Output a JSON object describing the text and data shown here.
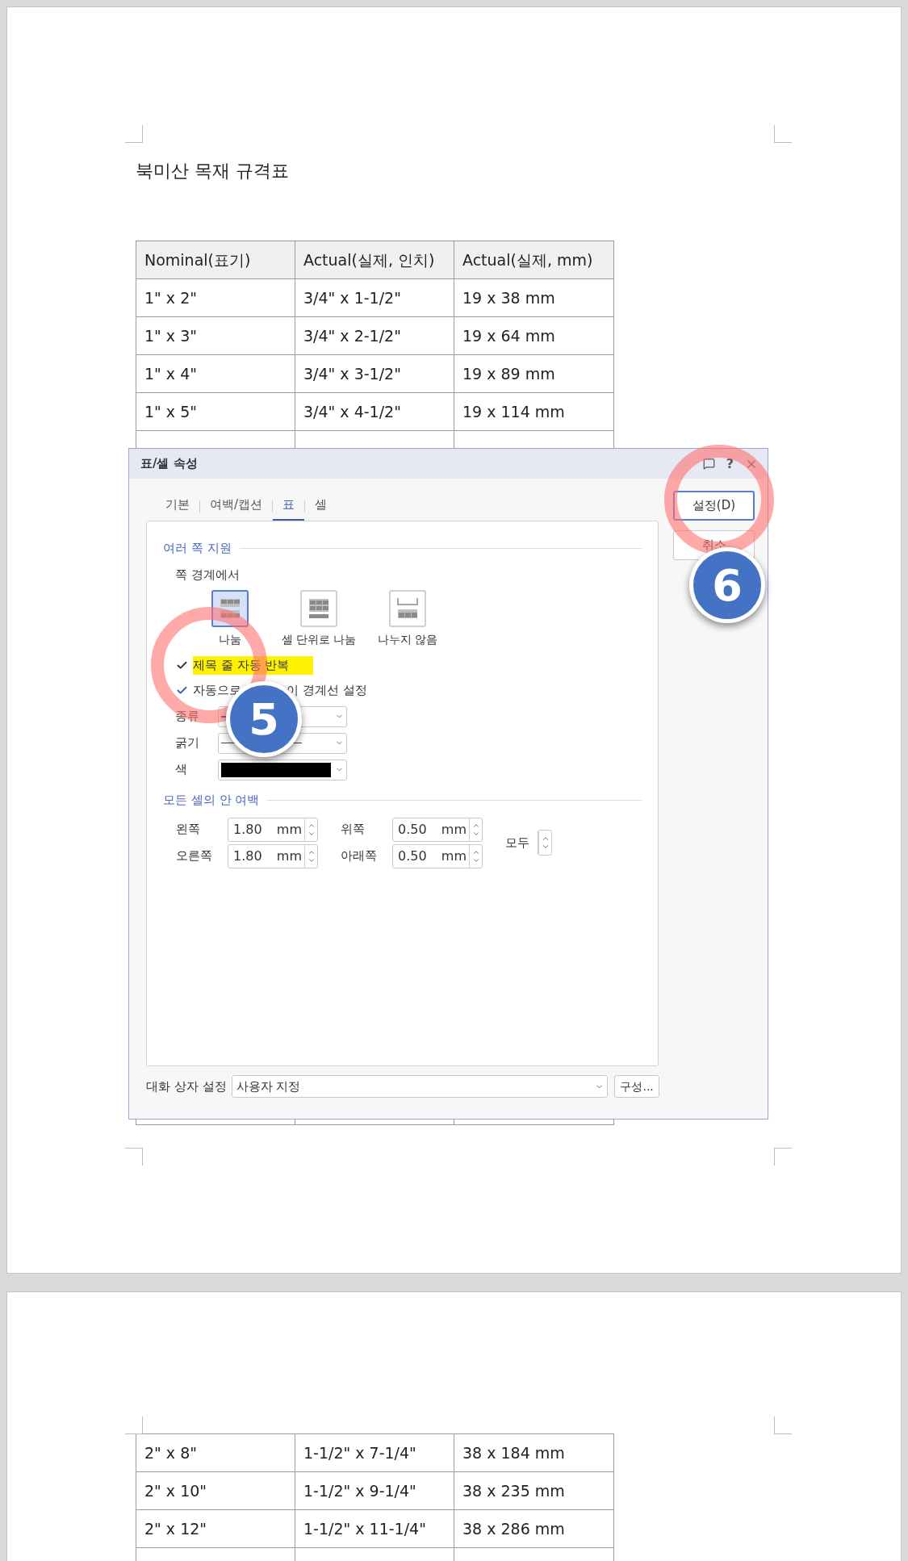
{
  "document": {
    "title": "북미산 목재 규격표",
    "columns": [
      "Nominal(표기)",
      "Actual(실제, 인치)",
      "Actual(실제, mm)"
    ],
    "rows": [
      [
        "1\" x 2\"",
        "3/4\" x 1-1/2\"",
        "19 x 38 mm"
      ],
      [
        "1\" x 3\"",
        "3/4\" x 2-1/2\"",
        "19 x 64 mm"
      ],
      [
        "1\" x 4\"",
        "3/4\" x 3-1/2\"",
        "19 x 89 mm"
      ],
      [
        "1\" x 5\"",
        "3/4\" x 4-1/2\"",
        "19 x 114 mm"
      ]
    ],
    "page_2_rows": [
      [
        "2\" x 8\"",
        "1-1/2\" x 7-1/4\"",
        "38 x 184 mm"
      ],
      [
        "2\" x 10\"",
        "1-1/2\" x 9-1/4\"",
        "38 x 235 mm"
      ],
      [
        "2\" x 12\"",
        "1-1/2\" x 11-1/4\"",
        "38 x 286 mm"
      ]
    ]
  },
  "dialog": {
    "title": "표/셀 속성",
    "help": "?",
    "tabs": [
      {
        "label": "기본",
        "selected": false
      },
      {
        "label": "여백/캡션",
        "selected": false
      },
      {
        "label": "표",
        "selected": true
      },
      {
        "label": "셀",
        "selected": false
      }
    ],
    "section_1": "여러 쪽 지원",
    "subheading": "쪽 경계에서",
    "split_options": [
      {
        "label": "나눔",
        "selected": true,
        "kind": "split"
      },
      {
        "label": "셀 단위로 나눔",
        "selected": false,
        "kind": "cell"
      },
      {
        "label": "나누지 않음",
        "selected": false,
        "kind": "none"
      }
    ],
    "checkboxes": [
      {
        "label": "제목 줄 자동 반복",
        "checked": true,
        "highlighted": true
      },
      {
        "label": "자동으로",
        "label_end": "이 경계선 설정",
        "checked": true,
        "highlighted": false
      }
    ],
    "line_fields": [
      {
        "label": "종류",
        "kind": "line"
      },
      {
        "label": "굵기",
        "kind": "thin-line"
      },
      {
        "label": "색",
        "kind": "color",
        "color": "#000000"
      }
    ],
    "section_2": "모든 셀의 안 여백",
    "margins": [
      {
        "label": "왼쪽",
        "value": "1.80",
        "unit": "mm"
      },
      {
        "label": "위쪽",
        "value": "0.50",
        "unit": "mm"
      },
      {
        "label": "오른쪽",
        "value": "1.80",
        "unit": "mm"
      },
      {
        "label": "아래쪽",
        "value": "0.50",
        "unit": "mm"
      }
    ],
    "all_label": "모두",
    "buttons": [
      "설정(D)",
      "취소"
    ],
    "footer": {
      "label": "대화 상자 설정",
      "value": "사용자 지정",
      "button": "구성..."
    }
  },
  "annotations": [
    {
      "number": "5",
      "kind": "checkbox"
    },
    {
      "number": "6",
      "kind": "button"
    }
  ]
}
